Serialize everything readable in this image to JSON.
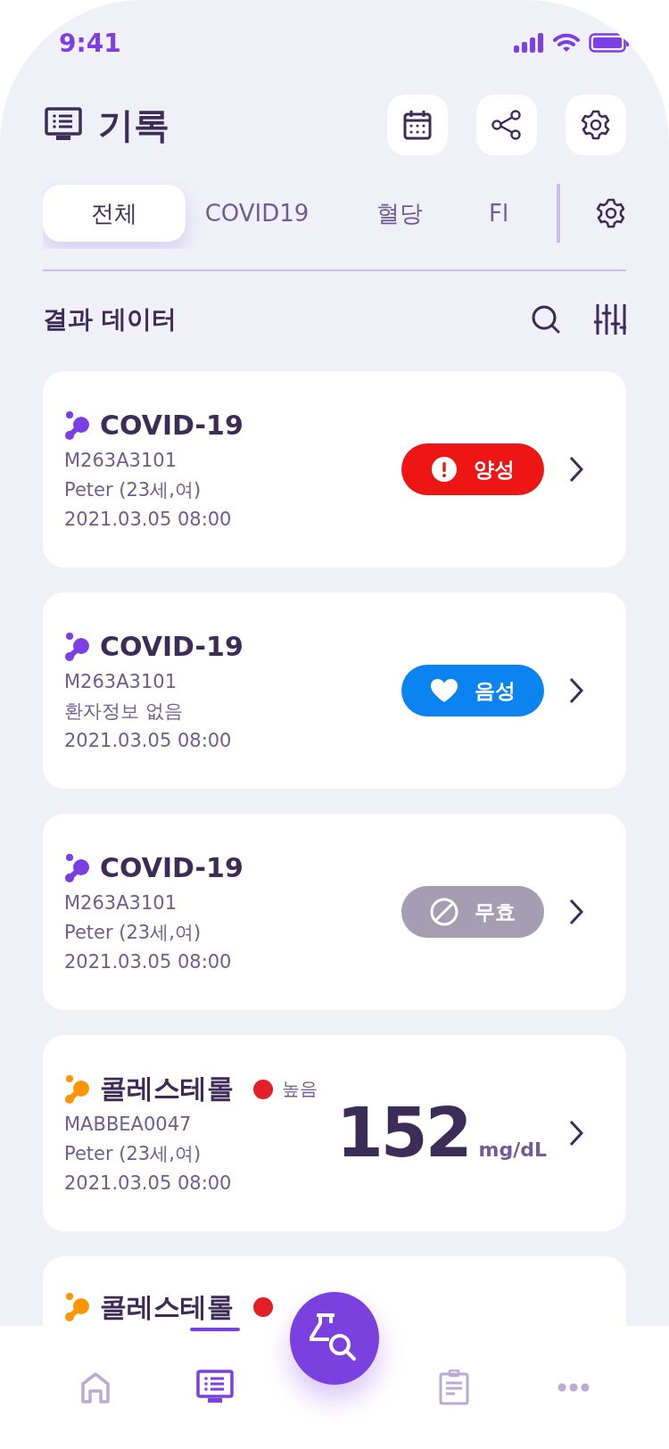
{
  "status_bar": {
    "time": "9:41"
  },
  "header": {
    "title": "기록"
  },
  "tabs": [
    {
      "label": "전체",
      "selected": true
    },
    {
      "label": "COVID19",
      "selected": false
    },
    {
      "label": "혈당",
      "selected": false
    },
    {
      "label": "Fl",
      "selected": false
    }
  ],
  "section": {
    "title": "결과 데이터"
  },
  "cards": [
    {
      "kind": "result",
      "title": "COVID-19",
      "color": "#7b3fe4",
      "code": "M263A3101",
      "patient": "Peter (23세,여)",
      "datetime": "2021.03.05  08:00",
      "badge": {
        "kind": "alert",
        "color": "#ee1515",
        "label": "양성"
      }
    },
    {
      "kind": "result",
      "title": "COVID-19",
      "color": "#7b3fe4",
      "code": "M263A3101",
      "patient": "환자정보 없음",
      "datetime": "2021.03.05  08:00",
      "badge": {
        "kind": "heart",
        "color": "#0a84f0",
        "label": "음성"
      }
    },
    {
      "kind": "result",
      "title": "COVID-19",
      "color": "#7b3fe4",
      "code": "M263A3101",
      "patient": "Peter (23세,여)",
      "datetime": "2021.03.05  08:00",
      "badge": {
        "kind": "blocked",
        "color": "#a59eb3",
        "label": "무효"
      }
    },
    {
      "kind": "value",
      "title": "콜레스테롤",
      "color": "#ff9500",
      "level": {
        "color": "#e32027",
        "label": "높음"
      },
      "code": "MABBEA0047",
      "patient": "Peter (23세,여)",
      "datetime": "2021.03.05  08:00",
      "value": "152",
      "unit": "mg/dL"
    },
    {
      "kind": "value",
      "title": "콜레스테롤",
      "color": "#ff9500",
      "level": {
        "color": "#e32027"
      }
    }
  ],
  "nav": [
    {
      "kind": "home",
      "selected": false
    },
    {
      "kind": "records",
      "selected": true
    },
    {
      "kind": "scan",
      "selected": false
    },
    {
      "kind": "report",
      "selected": false
    },
    {
      "kind": "more",
      "selected": false
    }
  ]
}
